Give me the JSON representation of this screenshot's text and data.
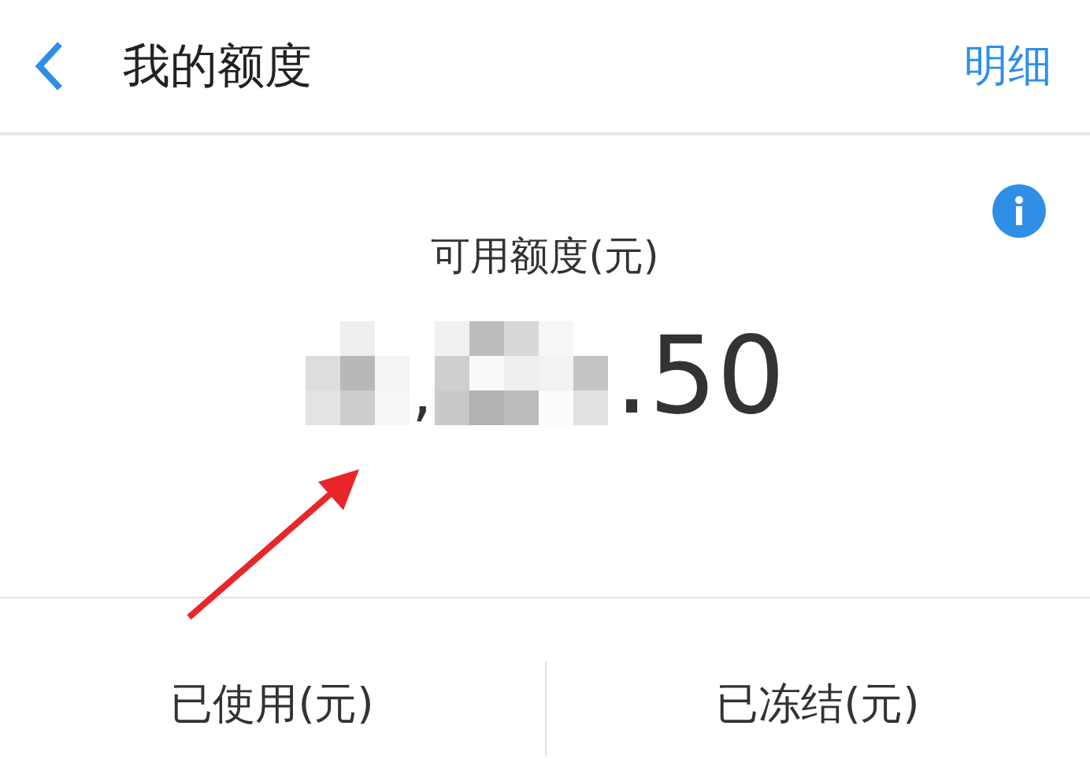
{
  "header": {
    "title": "我的额度",
    "action": "明细"
  },
  "credit": {
    "label": "可用额度(元)",
    "separator": ",",
    "amount_visible": ".50"
  },
  "summary": [
    {
      "label": "已使用(元)"
    },
    {
      "label": "已冻结(元)"
    }
  ]
}
